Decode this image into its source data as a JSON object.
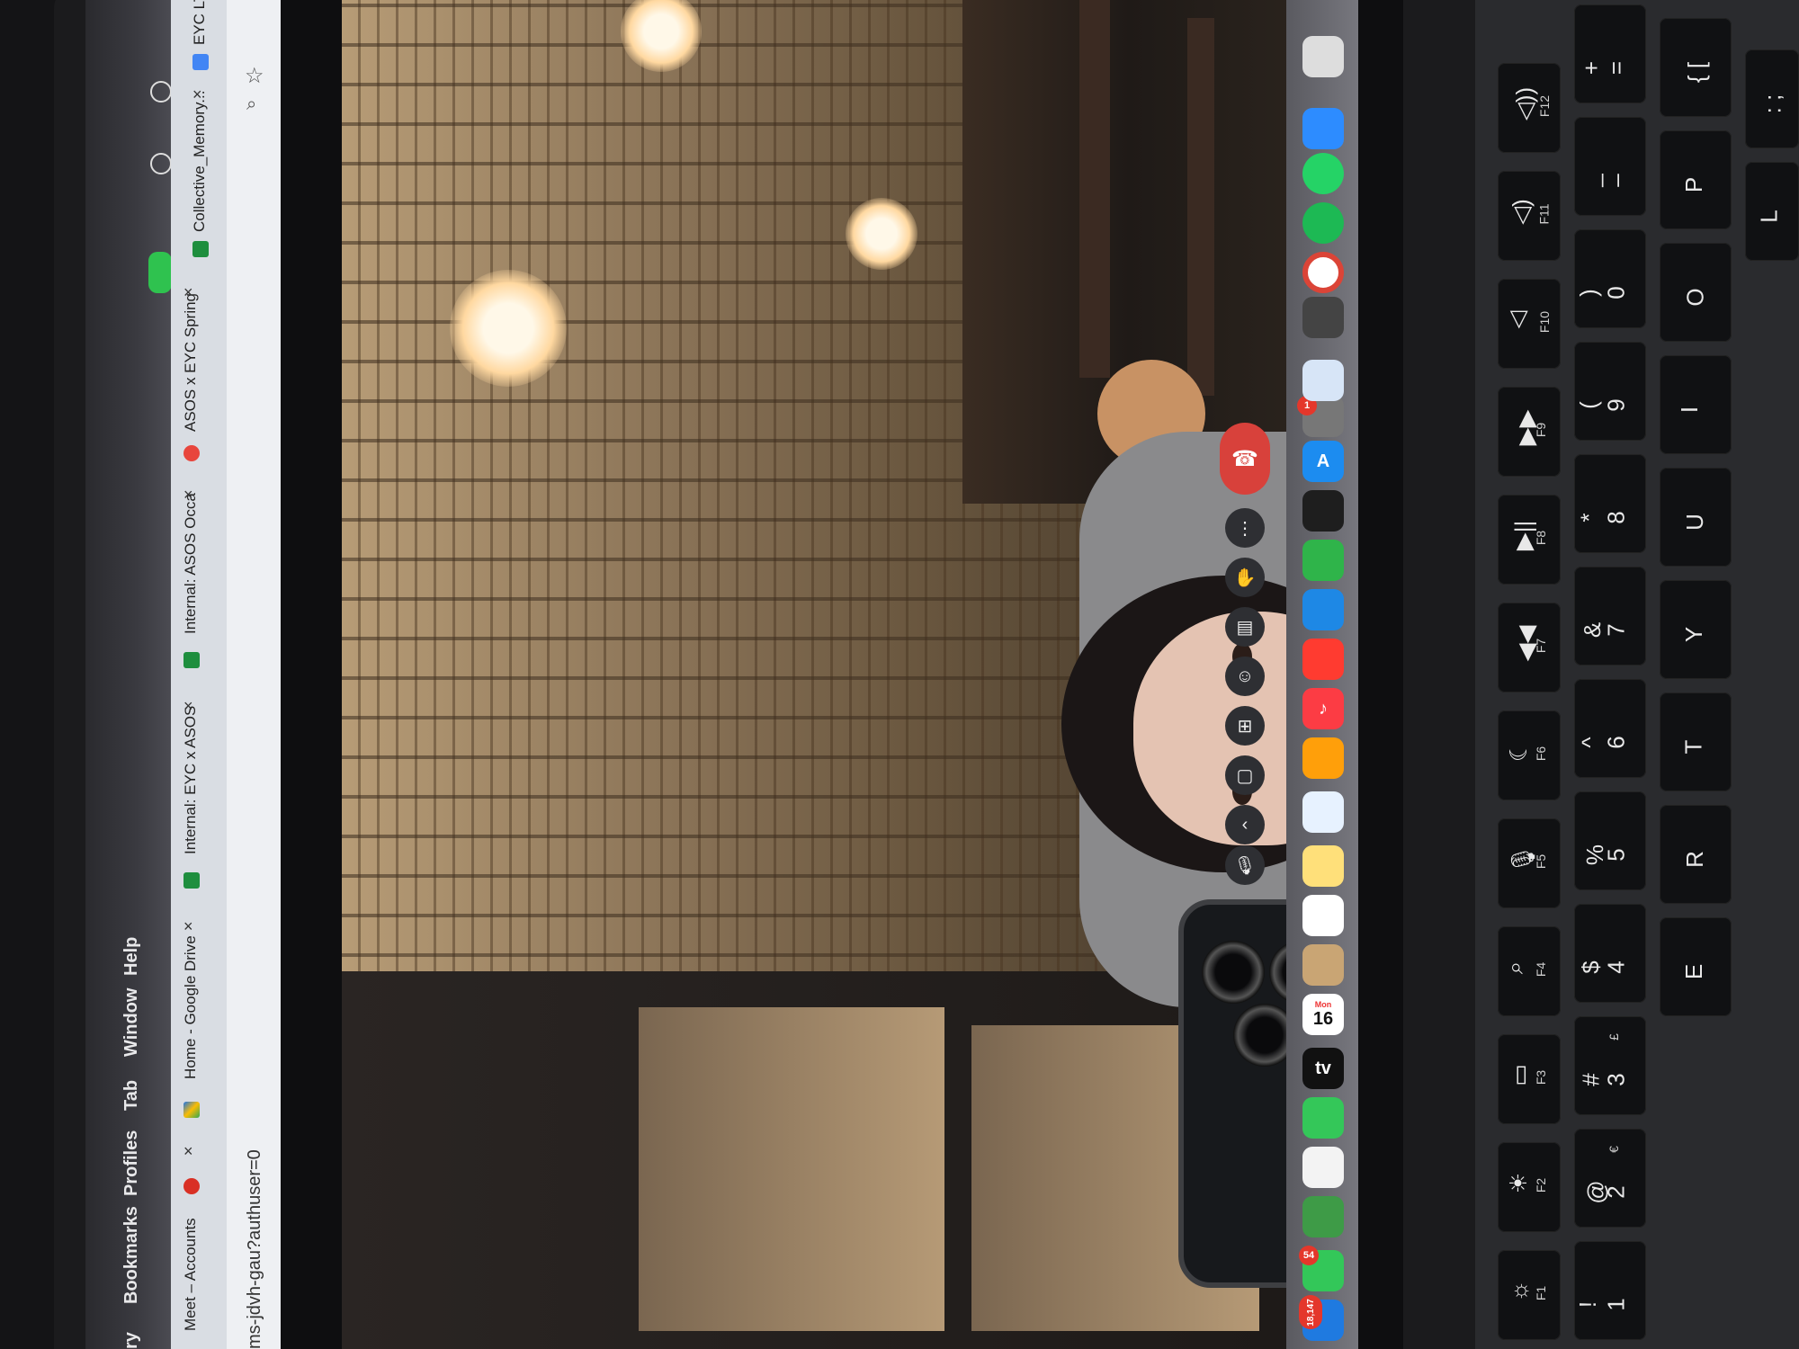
{
  "menubar": {
    "items": [
      "ry",
      "Bookmarks",
      "Profiles",
      "Tab",
      "Window",
      "Help"
    ]
  },
  "tabs": [
    {
      "label": "Meet – Accounts",
      "icon": "meet-recording-dot",
      "color": "#d93025"
    },
    {
      "label": "Home - Google Drive",
      "icon": "google-drive",
      "color": "#1a73e8"
    },
    {
      "label": "Internal: EYC x ASOS",
      "icon": "google-sheets",
      "color": "#1e8e3e"
    },
    {
      "label": "Internal: ASOS Occa",
      "icon": "google-sheets",
      "color": "#1e8e3e"
    },
    {
      "label": "ASOS x EYC Spring",
      "icon": "asos-logo",
      "color": "#e8453c"
    },
    {
      "label": "Collective_Memory...",
      "icon": "google-sheets",
      "color": "#1e8e3e"
    },
    {
      "label": "EYC LT",
      "icon": "google-docs",
      "color": "#4285f4"
    }
  ],
  "tab_close_glyph": "×",
  "addressbar": {
    "url": "ms-jdvh-gau?authuser=0"
  },
  "meet": {
    "end_call_icon": "phone-hangup-icon",
    "more_glyph": "⋮",
    "controls": [
      "raise-hand-icon",
      "captions-icon",
      "emoji-icon",
      "present-icon",
      "camera-icon",
      "mic-icon",
      "more-options-icon"
    ]
  },
  "dock": {
    "date_month": "Mon",
    "date_day": "16",
    "mail_badge": "18,147",
    "messages_badge": "54",
    "appstore_badge": "1",
    "apps": [
      "finder-icon",
      "settings-icon",
      "mail-icon",
      "messages-icon",
      "maps-icon",
      "photos-icon",
      "facetime-icon",
      "apple-tv-icon",
      "calendar-icon",
      "contacts-icon",
      "reminders-icon",
      "notes-icon",
      "freeform-icon",
      "pages-icon",
      "music-icon",
      "news-icon",
      "keynote-icon",
      "numbers-icon",
      "figma-icon",
      "app-store-icon",
      "google-chrome-icon",
      "spotify-icon",
      "whatsapp-icon",
      "zoom-icon"
    ]
  },
  "keyboard": {
    "row_fn": [
      {
        "label": "F1",
        "glyph": "☼"
      },
      {
        "label": "F2",
        "glyph": "☀"
      },
      {
        "label": "F3",
        "glyph": "▭"
      },
      {
        "label": "F4",
        "glyph": "⌕"
      },
      {
        "label": "F5",
        "glyph": "🎙"
      },
      {
        "label": "F6",
        "glyph": "☾"
      },
      {
        "label": "F7",
        "glyph": "◀◀"
      },
      {
        "label": "F8",
        "glyph": "▶||"
      },
      {
        "label": "F9",
        "glyph": "▶▶"
      },
      {
        "label": "F10",
        "glyph": "◁"
      },
      {
        "label": "F11",
        "glyph": "◁)"
      },
      {
        "label": "F12",
        "glyph": "◁))"
      }
    ],
    "row_num": [
      {
        "main": "1",
        "shift": "!"
      },
      {
        "main": "2",
        "shift": "@",
        "alt": "€"
      },
      {
        "main": "3",
        "shift": "#",
        "alt": "£"
      },
      {
        "main": "4",
        "shift": "$"
      },
      {
        "main": "5",
        "shift": "%"
      },
      {
        "main": "6",
        "shift": "^"
      },
      {
        "main": "7",
        "shift": "&"
      },
      {
        "main": "8",
        "shift": "*"
      },
      {
        "main": "9",
        "shift": "("
      },
      {
        "main": "0",
        "shift": ")"
      },
      {
        "main": "–",
        "shift": "_"
      },
      {
        "main": "=",
        "shift": "+"
      }
    ],
    "row_q": [
      "E",
      "R",
      "T",
      "Y",
      "U",
      "I",
      "O",
      "P",
      "{ [",
      "}"
    ],
    "row_a": [
      "L",
      ": ;"
    ]
  }
}
